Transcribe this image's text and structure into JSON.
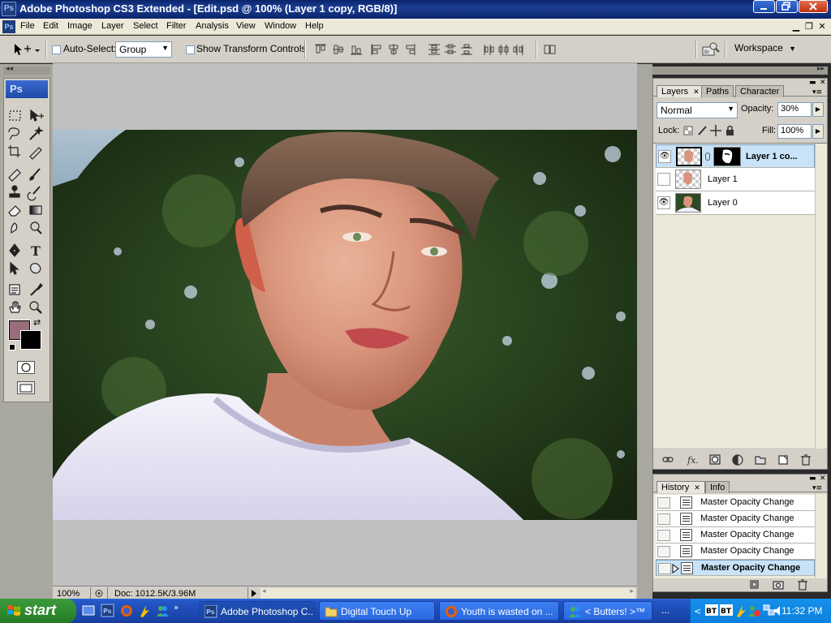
{
  "window": {
    "title": "Adobe Photoshop CS3 Extended - [Edit.psd @ 100% (Layer 1 copy, RGB/8)]",
    "app_icon_label": "Ps",
    "controls": [
      "minimize",
      "maximize",
      "close"
    ]
  },
  "menubar": {
    "items": [
      "File",
      "Edit",
      "Image",
      "Layer",
      "Select",
      "Filter",
      "Analysis",
      "View",
      "Window",
      "Help"
    ]
  },
  "options": {
    "auto_select_label": "Auto-Select:",
    "auto_select_checked": false,
    "auto_select_value": "Group",
    "show_transform_label": "Show Transform Controls",
    "show_transform_checked": false,
    "workspace_label": "Workspace"
  },
  "toolbox": {
    "logo": "Ps",
    "foreground_color": "#9a6e78",
    "background_color": "#000000",
    "tools": [
      "rectangular-marquee",
      "move",
      "lasso",
      "magic-wand",
      "crop",
      "eyedropper-slice",
      "healing-brush",
      "brush",
      "clone-stamp",
      "history-brush",
      "eraser",
      "gradient",
      "smudge",
      "dodge",
      "pen",
      "type",
      "path-selection",
      "custom-shape",
      "notes",
      "eyedropper",
      "hand",
      "zoom",
      "quick-mask",
      "screen-mode"
    ]
  },
  "document": {
    "zoom": "100%",
    "doc_size": "Doc: 1012.5K/3.96M"
  },
  "layers_panel": {
    "tabs": [
      "Layers",
      "Paths",
      "Character"
    ],
    "active_tab": "Layers",
    "blend_mode": "Normal",
    "opacity_label": "Opacity:",
    "opacity_value": "30%",
    "lock_label": "Lock:",
    "fill_label": "Fill:",
    "fill_value": "100%",
    "layers": [
      {
        "name": "Layer 1 co...",
        "visible": true,
        "selected": true,
        "has_mask": true
      },
      {
        "name": "Layer 1",
        "visible": false,
        "selected": false,
        "has_mask": false
      },
      {
        "name": "Layer 0",
        "visible": true,
        "selected": false,
        "has_mask": false
      }
    ]
  },
  "history_panel": {
    "tabs": [
      "History",
      "Info"
    ],
    "active_tab": "History",
    "states": [
      {
        "label": "Master Opacity Change",
        "selected": false
      },
      {
        "label": "Master Opacity Change",
        "selected": false
      },
      {
        "label": "Master Opacity Change",
        "selected": false
      },
      {
        "label": "Master Opacity Change",
        "selected": false
      },
      {
        "label": "Master Opacity Change",
        "selected": true
      }
    ]
  },
  "taskbar": {
    "start_label": "start",
    "buttons": [
      {
        "label": "Adobe Photoshop C...",
        "active": true,
        "icon": "photoshop-icon"
      },
      {
        "label": "Digital Touch Up",
        "active": false,
        "icon": "folder-icon"
      },
      {
        "label": "Youth is wasted on ...",
        "active": false,
        "icon": "firefox-icon"
      },
      {
        "label": "< Butters! >™",
        "active": false,
        "icon": "messenger-icon"
      }
    ],
    "overflow": "...",
    "clock": "11:32 PM"
  }
}
